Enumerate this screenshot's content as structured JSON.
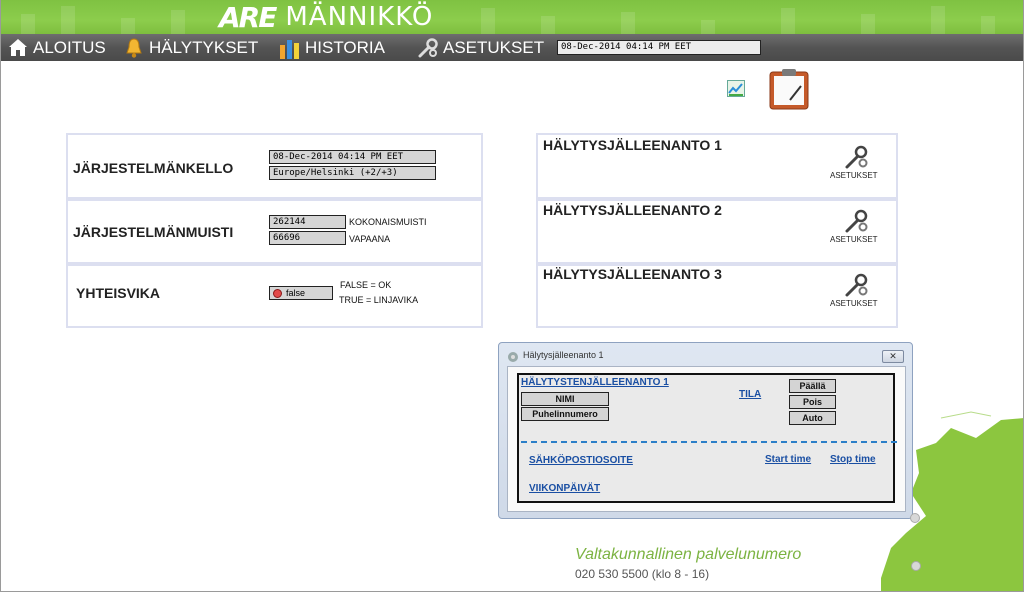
{
  "brand": {
    "logo_mark": "ARE",
    "name": "MÄNNIKKÖ"
  },
  "nav": {
    "items": [
      {
        "label": "ALOITUS",
        "icon": "home-icon"
      },
      {
        "label": "HÄLYTYKSET",
        "icon": "bell-icon"
      },
      {
        "label": "HISTORIA",
        "icon": "bar-chart-icon"
      },
      {
        "label": "ASETUKSET",
        "icon": "wrench-icon"
      }
    ],
    "datetime": "08-Dec-2014 04:14 PM EET"
  },
  "system": {
    "clock": {
      "title": "JÄRJESTELMÄNKELLO",
      "datetime": "08-Dec-2014 04:14 PM EET",
      "timezone": "Europe/Helsinki (+2/+3)"
    },
    "memory": {
      "title": "JÄRJESTELMÄNMUISTI",
      "total_value": "262144",
      "total_label": "KOKONAISMUISTI",
      "free_value": "66696",
      "free_label": "VAPAANA"
    },
    "fault": {
      "title": "YHTEISVIKA",
      "value": "false",
      "legend_ok": "FALSE = OK",
      "legend_fault": "TRUE = LINJAVIKA"
    }
  },
  "relays": [
    {
      "title": "HÄLYTYSJÄLLEENANTO 1",
      "settings_label": "ASETUKSET"
    },
    {
      "title": "HÄLYTYSJÄLLEENANTO 2",
      "settings_label": "ASETUKSET"
    },
    {
      "title": "HÄLYTYSJÄLLEENANTO 3",
      "settings_label": "ASETUKSET"
    }
  ],
  "dialog": {
    "title": "Hälytysjälleenanto 1",
    "heading": "HÄLYTYSTENJÄLLEENANTO 1",
    "name_button": "NIMI",
    "phone_button": "Puhelinnumero",
    "state_label": "TILA",
    "state_options": [
      "Päällä",
      "Pois",
      "Auto"
    ],
    "email_label": "SÄHKÖPOSTIOSOITE",
    "start_time": "Start time",
    "stop_time": "Stop time",
    "weekdays_label": "VIIKONPÄIVÄT"
  },
  "footer": {
    "tagline": "Valtakunnallinen palvelunumero",
    "phone": "020 530 5500 (klo 8 - 16)"
  },
  "colors": {
    "brand_green": "#8ccd4c",
    "nav_gray": "#545454",
    "link_blue": "#1a4fa3",
    "fault_red": "#e24a4a"
  }
}
